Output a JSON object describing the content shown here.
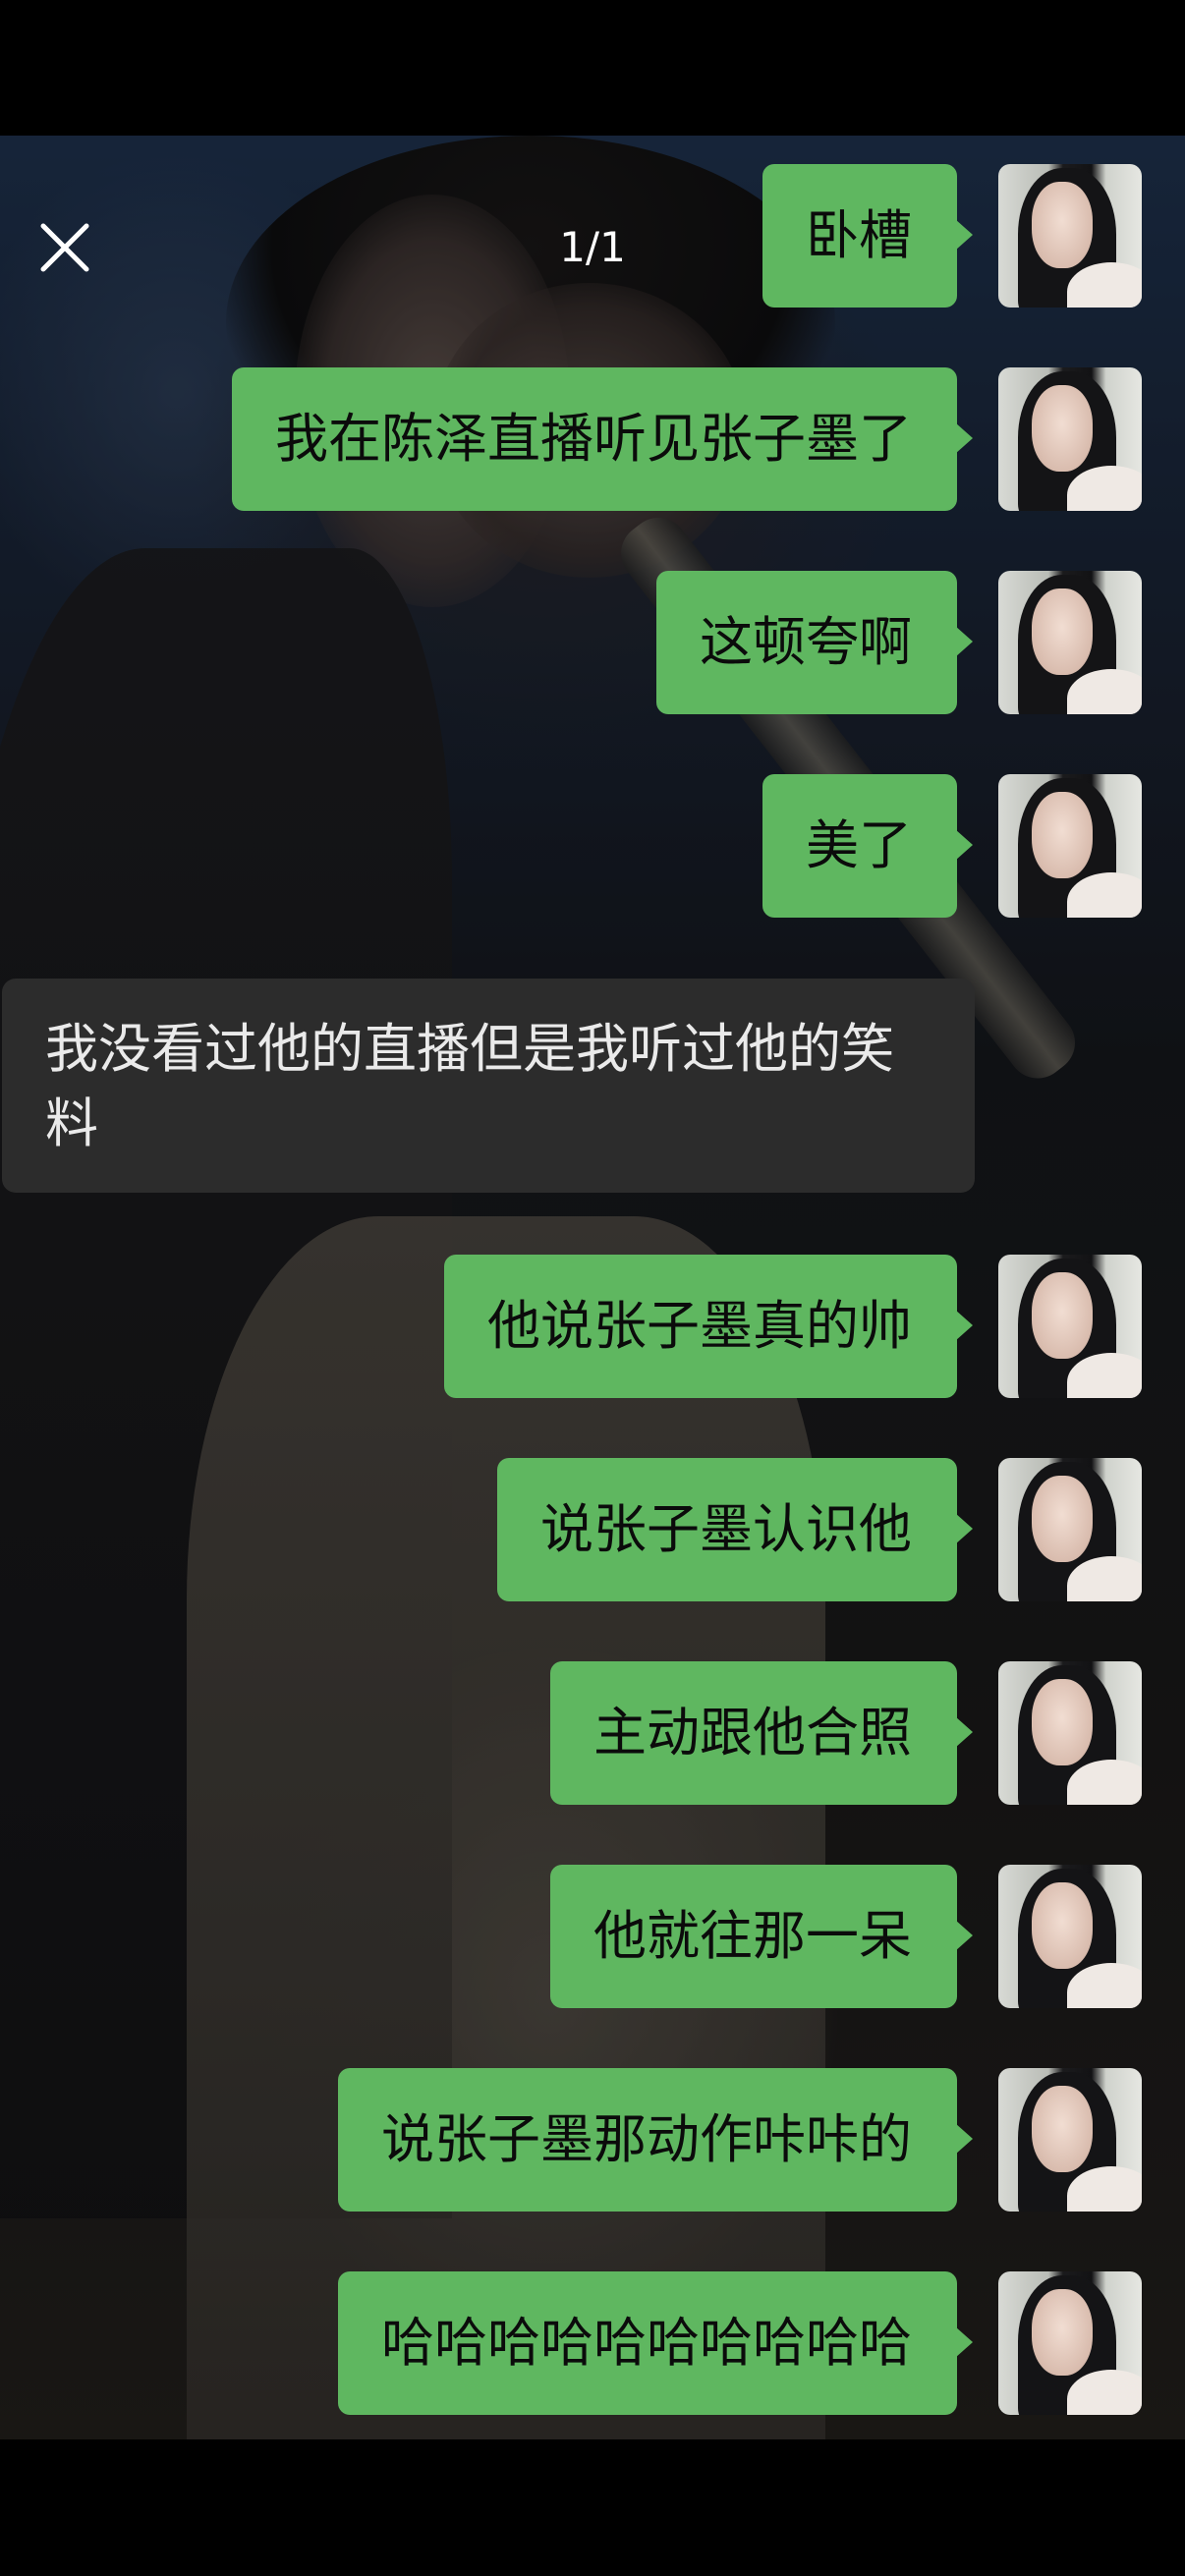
{
  "header": {
    "page_counter": "1/1"
  },
  "messages": [
    {
      "side": "right",
      "text": "卧槽"
    },
    {
      "side": "right",
      "text": "我在陈泽直播听见张子墨了"
    },
    {
      "side": "right",
      "text": "这顿夸啊"
    },
    {
      "side": "right",
      "text": "美了"
    },
    {
      "side": "left",
      "text": "我没看过他的直播但是我听过他的笑料"
    },
    {
      "side": "right",
      "text": "他说张子墨真的帅"
    },
    {
      "side": "right",
      "text": "说张子墨认识他"
    },
    {
      "side": "right",
      "text": "主动跟他合照"
    },
    {
      "side": "right",
      "text": "他就往那一呆"
    },
    {
      "side": "right",
      "text": "说张子墨那动作咔咔的"
    },
    {
      "side": "right",
      "text": "哈哈哈哈哈哈哈哈哈哈"
    }
  ],
  "colors": {
    "own_bubble": "#5fb760",
    "other_bubble": "#2c2c2c",
    "background": "#000000"
  },
  "icons": {
    "close": "close-icon"
  }
}
